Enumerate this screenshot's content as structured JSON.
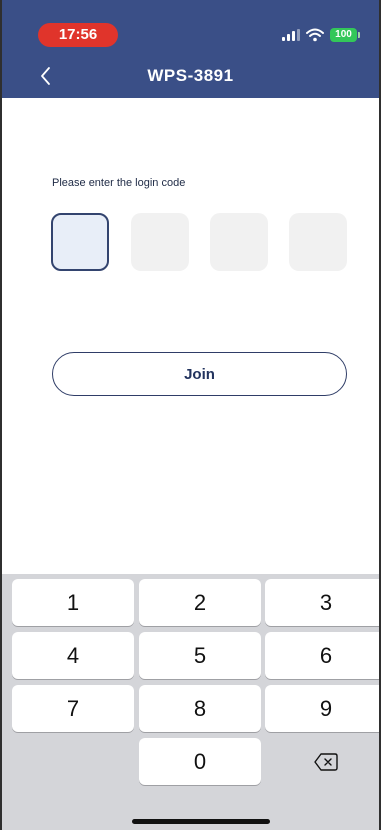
{
  "status_bar": {
    "time": "17:56",
    "battery": "100",
    "icons": [
      "signal-icon",
      "wifi-icon",
      "battery-icon"
    ],
    "time_pill_color": "#e0342b",
    "battery_color": "#33c759"
  },
  "nav": {
    "title": "WPS-3891",
    "back_icon": "chevron-left-icon",
    "background_color": "#3a4f87"
  },
  "login": {
    "prompt": "Please enter the login code",
    "code_boxes": [
      "",
      "",
      "",
      ""
    ],
    "active_box": 1,
    "join_label": "Join"
  },
  "keypad": {
    "rows": [
      [
        "1",
        "2",
        "3"
      ],
      [
        "4",
        "5",
        "6"
      ],
      [
        "7",
        "8",
        "9"
      ],
      [
        "",
        "0",
        "backspace-icon"
      ]
    ]
  }
}
